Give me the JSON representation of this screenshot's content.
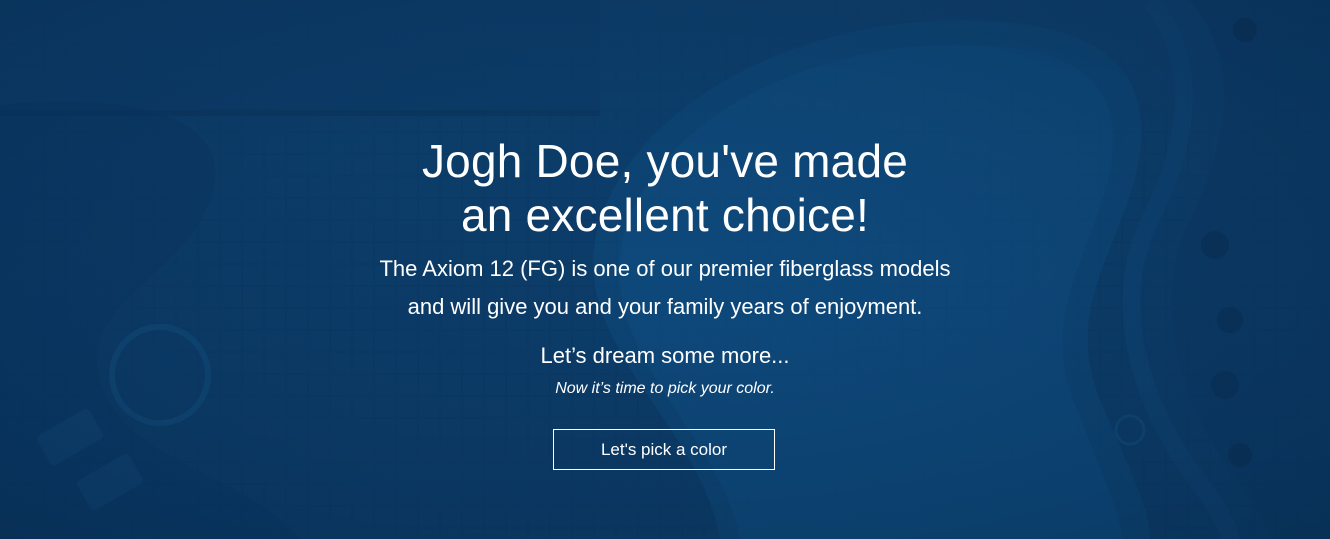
{
  "hero": {
    "headline_line1": "Jogh Doe, you've made",
    "headline_line2": "an excellent choice!",
    "subtext_line1": "The Axiom 12 (FG) is one of our premier fiberglass models",
    "subtext_line2": "and will give you and your family years of enjoyment.",
    "dream_text": "Let’s dream some more...",
    "pick_note": "Now it’s time to pick your color.",
    "cta_label": "Let's pick a color"
  },
  "colors": {
    "background": "#0b3a66",
    "text": "#ffffff",
    "button_border": "#ffffff"
  }
}
